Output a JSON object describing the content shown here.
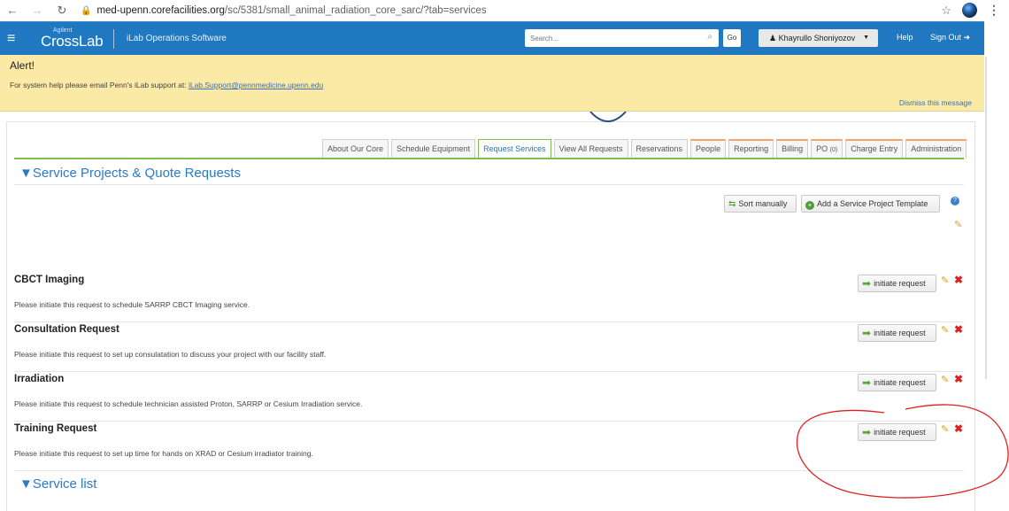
{
  "browser": {
    "url_host": "med-upenn.corefacilities.org",
    "url_path": "/sc/5381/small_animal_radiation_core_sarc/?tab=services"
  },
  "header": {
    "logo_small": "Agilent",
    "logo_main": "CrossLab",
    "app_name": "iLab Operations Software",
    "search_placeholder": "Search...",
    "go_label": "Go",
    "user_name": "Khayrullo Shoniyozov",
    "help_label": "Help",
    "signout_label": "Sign Out"
  },
  "alert": {
    "title": "Alert!",
    "message": "For system help please email Penn's iLab support at: ",
    "email": "iLab.Support@pennmedicine.upenn.edu",
    "dismiss": "Dismiss this message"
  },
  "tabs": [
    {
      "label": "About Our Core",
      "state": "normal"
    },
    {
      "label": "Schedule Equipment",
      "state": "normal"
    },
    {
      "label": "Request Services",
      "state": "active"
    },
    {
      "label": "View All Requests",
      "state": "normal"
    },
    {
      "label": "Reservations",
      "state": "normal"
    },
    {
      "label": "People",
      "state": "orange"
    },
    {
      "label": "Reporting",
      "state": "orange"
    },
    {
      "label": "Billing",
      "state": "orange"
    },
    {
      "label": "PO",
      "count": "(0)",
      "state": "orange"
    },
    {
      "label": "Charge Entry",
      "state": "orange"
    },
    {
      "label": "Administration",
      "state": "orange"
    }
  ],
  "sections": {
    "projects_title": "▼Service Projects & Quote Requests",
    "service_list_title": "▼Service list"
  },
  "toolbar": {
    "sort_label": "Sort manually",
    "add_template_label": "Add a Service Project Template"
  },
  "services": [
    {
      "title": "CBCT Imaging",
      "description": "Please initiate this request to schedule SARRP CBCT Imaging service.",
      "button": "initiate request"
    },
    {
      "title": "Consultation Request",
      "description": "Please initiate this request to set up consulatation to discuss your project with our facility staff.",
      "button": "initiate request"
    },
    {
      "title": "Irradiation",
      "description": "Please initiate this request to schedule technician assisted Proton, SARRP or Cesium Irradiation service.",
      "button": "initiate request"
    },
    {
      "title": "Training Request",
      "description": "Please initiate this request to set up time for hands on XRAD or Cesium irradiator training.",
      "button": "initiate request"
    }
  ],
  "colors": {
    "header_blue": "#2078c0",
    "alert_yellow": "#fbe9a6",
    "tab_active_green": "#7cbf4e",
    "section_title_blue": "#2a7ac7",
    "annotation_red": "#e02020"
  }
}
